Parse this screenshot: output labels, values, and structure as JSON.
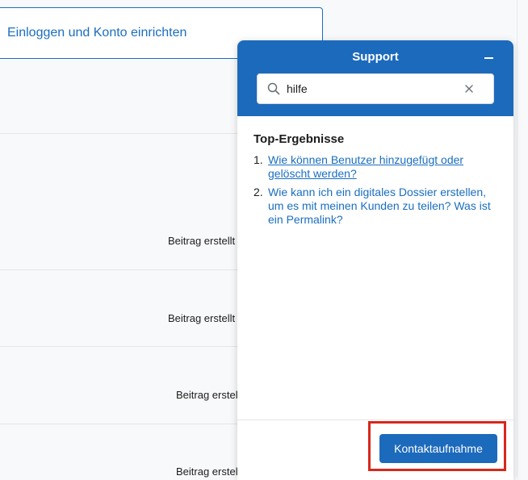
{
  "background": {
    "login_button_label": "Einloggen und Konto einrichten",
    "post_meta": [
      "Beitrag erstellt",
      "Beitrag erstellt",
      "Beitrag erstel",
      "Beitrag erstel"
    ]
  },
  "support": {
    "title": "Support",
    "minimize_icon": "minus-icon",
    "search": {
      "value": "hilfe",
      "icon": "search-icon",
      "clear_icon": "close-icon"
    },
    "results_heading": "Top-Ergebnisse",
    "results": [
      {
        "number": "1.",
        "text": "Wie können Benutzer hinzugefügt oder gelöscht werden?"
      },
      {
        "number": "2.",
        "text": "Wie kann ich ein digitales Dossier erstellen, um es mit meinen Kunden zu teilen? Was ist ein Permalink?"
      }
    ],
    "contact_button_label": "Kontaktaufnahme"
  },
  "colors": {
    "accent": "#1c6abc",
    "link": "#1a6ec1",
    "highlight": "#d8271c"
  }
}
